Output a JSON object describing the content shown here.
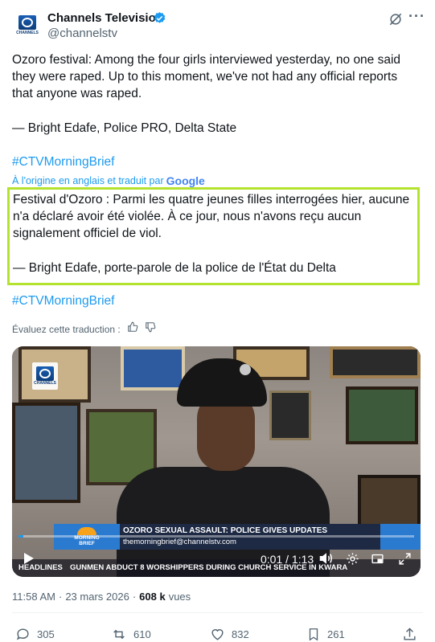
{
  "header": {
    "name": "Channels Television",
    "handle": "@channelstv",
    "logo_text": "CHANNELS",
    "more": "···"
  },
  "tweet": {
    "line1": "Ozoro festival: Among the four girls interviewed yesterday, no one said",
    "line2": "they were raped. Up to this moment, we've not had any official reports",
    "line3": "that anyone was raped.",
    "attribution": "— Bright Edafe, Police PRO, Delta State",
    "hashtag": "#CTVMorningBrief"
  },
  "translation": {
    "note_prefix": "À l'origine en anglais et traduit par",
    "provider": "Google",
    "line1": "Festival d'Ozoro : Parmi les quatre jeunes filles interrogées hier, aucune",
    "line2": "n'a déclaré avoir été violée. À ce jour, nous n'avons reçu aucun",
    "line3": "signalement officiel de viol.",
    "attribution": "— Bright Edafe, porte-parole de la police de l'État du Delta",
    "hashtag": "#CTVMorningBrief",
    "rate_label": "Évaluez cette traduction :"
  },
  "video": {
    "channel_bug": "CHANNELS",
    "banner_title": "OZORO SEXUAL ASSAULT: POLICE GIVES UPDATES",
    "banner_sub": "themorningbrief@channelstv.com",
    "show_logo_1": "MORNING",
    "show_logo_2": "BRIEF",
    "ticker_label": "HEADLINES",
    "ticker_text": "GUNMEN ABDUCT 8 WORSHIPPERS DURING CHURCH SERVICE IN KWARA",
    "time": "0:01 / 1:13",
    "progress": 0.013
  },
  "meta": {
    "time": "11:58 AM",
    "sep": "·",
    "date": "23 mars 2026",
    "views": "608 k",
    "views_label": "vues"
  },
  "actions": {
    "replies": "305",
    "reposts": "610",
    "likes": "832",
    "bookmarks": "261"
  },
  "colors": {
    "accent": "#1d9bf0",
    "highlight": "#b4e32f",
    "verified": "#1d9bf0"
  }
}
